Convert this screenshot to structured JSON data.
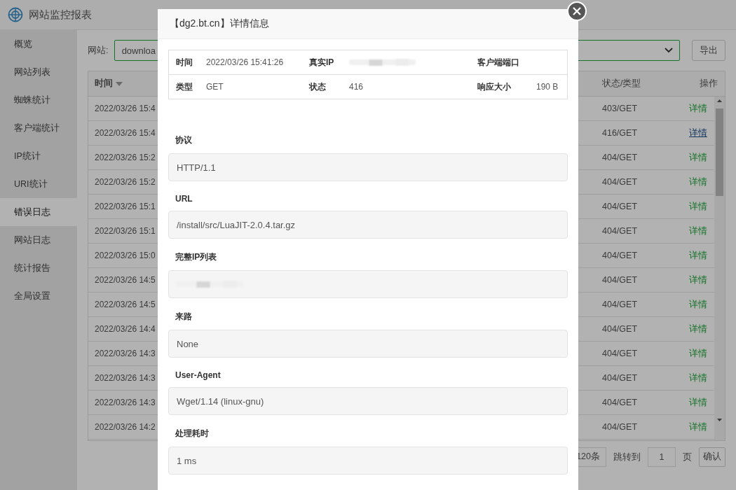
{
  "app": {
    "title": "网站监控报表"
  },
  "sidebar": {
    "items": [
      {
        "label": "概览",
        "selected": false
      },
      {
        "label": "网站列表",
        "selected": false
      },
      {
        "label": "蜘蛛统计",
        "selected": false
      },
      {
        "label": "客户端统计",
        "selected": false
      },
      {
        "label": "IP统计",
        "selected": false
      },
      {
        "label": "URI统计",
        "selected": false
      },
      {
        "label": "错误日志",
        "selected": true
      },
      {
        "label": "网站日志",
        "selected": false
      },
      {
        "label": "统计报告",
        "selected": false
      },
      {
        "label": "全局设置",
        "selected": false
      }
    ]
  },
  "filter": {
    "label": "网站:",
    "site": "downloa",
    "export_button": "导出"
  },
  "table": {
    "columns": [
      {
        "label": "时间",
        "sorted": true
      },
      {
        "label": "状态/类型",
        "sorted": false
      },
      {
        "label": "操作",
        "sorted": false
      }
    ],
    "rows": [
      {
        "time": "2022/03/26 15:4",
        "status": "403/GET",
        "action": "详情",
        "hovered": false
      },
      {
        "time": "2022/03/26 15:4",
        "status": "416/GET",
        "action": "详情",
        "hovered": true
      },
      {
        "time": "2022/03/26 15:2",
        "status": "404/GET",
        "action": "详情",
        "hovered": false
      },
      {
        "time": "2022/03/26 15:2",
        "status": "404/GET",
        "action": "详情",
        "hovered": false
      },
      {
        "time": "2022/03/26 15:1",
        "status": "404/GET",
        "action": "详情",
        "hovered": false
      },
      {
        "time": "2022/03/26 15:1",
        "status": "404/GET",
        "action": "详情",
        "hovered": false
      },
      {
        "time": "2022/03/26 15:0",
        "status": "404/GET",
        "action": "详情",
        "hovered": false
      },
      {
        "time": "2022/03/26 14:5",
        "status": "404/GET",
        "action": "详情",
        "hovered": false
      },
      {
        "time": "2022/03/26 14:5",
        "status": "404/GET",
        "action": "详情",
        "hovered": false
      },
      {
        "time": "2022/03/26 14:4",
        "status": "404/GET",
        "action": "详情",
        "hovered": false
      },
      {
        "time": "2022/03/26 14:3",
        "status": "404/GET",
        "action": "详情",
        "hovered": false
      },
      {
        "time": "2022/03/26 14:3",
        "status": "404/GET",
        "action": "详情",
        "hovered": false
      },
      {
        "time": "2022/03/26 14:3",
        "status": "404/GET",
        "action": "详情",
        "hovered": false
      },
      {
        "time": "2022/03/26 14:2",
        "status": "404/GET",
        "action": "详情",
        "hovered": false
      }
    ]
  },
  "pagination": {
    "total": "120条",
    "jump_label": "跳转到",
    "page": "1",
    "page_unit": "页",
    "confirm_button": "确认"
  },
  "dialog": {
    "title": "【dg2.bt.cn】详情信息",
    "info": [
      [
        {
          "label": "时间",
          "value": "2022/03/26 15:41:26",
          "kind": "text"
        },
        {
          "label": "真实IP",
          "kind": "blurred"
        },
        {
          "label": "客户端端口",
          "kind": "text"
        }
      ],
      [
        {
          "label": "类型",
          "value": "GET",
          "kind": "text"
        },
        {
          "label": "状态",
          "value": "416",
          "kind": "text"
        },
        {
          "label": "响应大小",
          "value": "190 B",
          "kind": "text"
        }
      ]
    ],
    "fields": [
      {
        "label": "协议",
        "value": "HTTP/1.1",
        "kind": "text"
      },
      {
        "label": "URL",
        "value": "/install/src/LuaJIT-2.0.4.tar.gz",
        "kind": "text"
      },
      {
        "label": "完整IP列表",
        "kind": "blurred"
      },
      {
        "label": "来路",
        "value": "None",
        "kind": "text"
      },
      {
        "label": "User-Agent",
        "value": "Wget/1.14 (linux-gnu)",
        "kind": "text"
      },
      {
        "label": "处理耗时",
        "value": "1 ms",
        "kind": "text"
      }
    ]
  }
}
